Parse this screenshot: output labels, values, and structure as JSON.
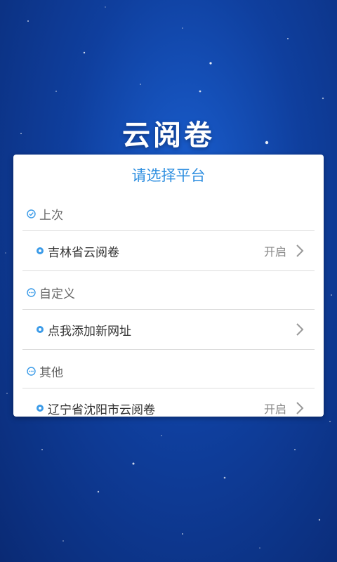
{
  "app_title": "云阅卷",
  "dialog": {
    "title": "请选择平台",
    "sections": [
      {
        "header": "上次",
        "header_icon": "check-circle-icon",
        "items": [
          {
            "label": "吉林省云阅卷",
            "status": "开启"
          }
        ]
      },
      {
        "header": "自定义",
        "header_icon": "ellipsis-circle-icon",
        "items": [
          {
            "label": "点我添加新网址",
            "status": ""
          }
        ]
      },
      {
        "header": "其他",
        "header_icon": "ellipsis-circle-icon",
        "items": [
          {
            "label": "辽宁省沈阳市云阅卷",
            "status": "开启"
          }
        ]
      }
    ]
  },
  "colors": {
    "accent": "#2f8fe0",
    "background": "#0f3f9e"
  }
}
